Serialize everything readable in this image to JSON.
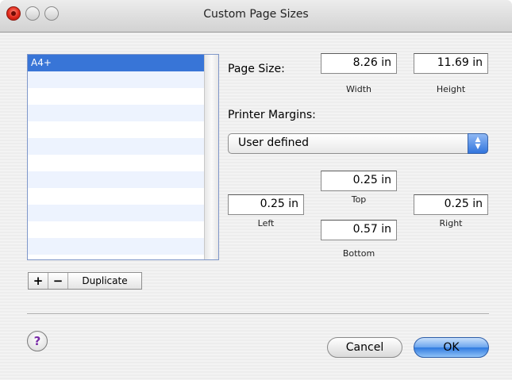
{
  "window": {
    "title": "Custom Page Sizes"
  },
  "list": {
    "items": [
      "A4+",
      "",
      "",
      "",
      "",
      "",
      "",
      "",
      "",
      "",
      "",
      ""
    ],
    "selected": "A4+"
  },
  "list_controls": {
    "add": "+",
    "remove": "−",
    "duplicate": "Duplicate"
  },
  "page_size": {
    "label": "Page Size:",
    "width_value": "8.26 in",
    "width_label": "Width",
    "height_value": "11.69 in",
    "height_label": "Height"
  },
  "margins": {
    "label": "Printer Margins:",
    "popup_value": "User defined",
    "top_value": "0.25 in",
    "top_label": "Top",
    "left_value": "0.25 in",
    "left_label": "Left",
    "right_value": "0.25 in",
    "right_label": "Right",
    "bottom_value": "0.57 in",
    "bottom_label": "Bottom"
  },
  "buttons": {
    "help": "?",
    "cancel": "Cancel",
    "ok": "OK"
  },
  "colors": {
    "selection": "#3875d7",
    "default_button": "#2f7ae0",
    "close_light": "#e1281a"
  }
}
